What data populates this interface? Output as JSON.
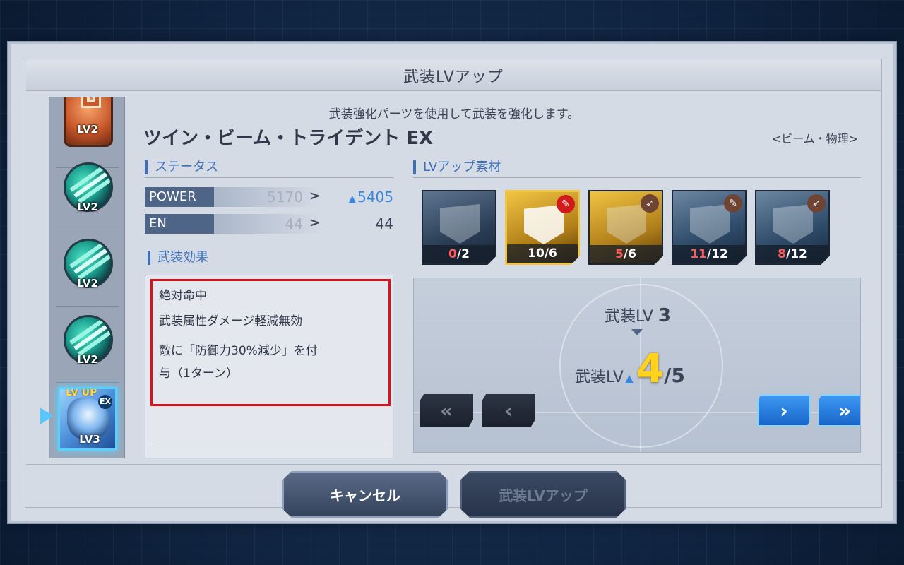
{
  "dialog": {
    "title": "武装LVアップ",
    "subtitle": "武装強化パーツを使用して武装を強化します。"
  },
  "weapon": {
    "name": "ツイン・ビーム・トライデント EX",
    "type": "<ビーム・物理>"
  },
  "sidebar": {
    "slots": [
      {
        "label": "LV2",
        "icon": "orange-part-icon"
      },
      {
        "label": "LV2",
        "icon": "beam-orb-icon"
      },
      {
        "label": "LV2",
        "icon": "beam-orb-icon"
      },
      {
        "label": "LV2",
        "icon": "beam-orb-icon"
      }
    ],
    "selected": {
      "lvup": "LV UP",
      "badge": "EX",
      "label": "LV3"
    }
  },
  "status": {
    "heading": "ステータス",
    "rows": [
      {
        "name": "POWER",
        "old": "5170",
        "new": "5405",
        "increased": true
      },
      {
        "name": "EN",
        "old": "44",
        "new": "44",
        "increased": false
      }
    ],
    "arrow": ">"
  },
  "effect": {
    "heading": "武装効果",
    "lines": [
      "絶対命中",
      "武装属性ダメージ軽減無効",
      "敵に「防御力30%減少」を付",
      "与（1ターン）"
    ]
  },
  "materials": {
    "heading": "LVアップ素材",
    "items": [
      {
        "have": "0",
        "need": "/2",
        "style": "dark",
        "badge": ""
      },
      {
        "have": "10",
        "need": "/6",
        "style": "gold",
        "badge": "red-feather-icon",
        "selected": true
      },
      {
        "have": "5",
        "need": "/6",
        "style": "gold",
        "badge": "brown-arrow-icon"
      },
      {
        "have": "11",
        "need": "/12",
        "style": "blue",
        "badge": "brown-feather-icon"
      },
      {
        "have": "8",
        "need": "/12",
        "style": "blue",
        "badge": "brown-arrow-icon"
      }
    ]
  },
  "level": {
    "current_label": "武装LV",
    "current_value": "3",
    "new_label": "武装LV",
    "new_value": "4",
    "max": "/5",
    "buttons": {
      "min": "«",
      "dec": "‹",
      "inc": "›",
      "max": "»"
    }
  },
  "footer": {
    "cancel": "キャンセル",
    "confirm": "武装LVアップ"
  },
  "colors": {
    "accent": "#3e6eb8",
    "highlight": "#e0101a",
    "level_new": "#ffd21d",
    "increase": "#3a86dd"
  }
}
